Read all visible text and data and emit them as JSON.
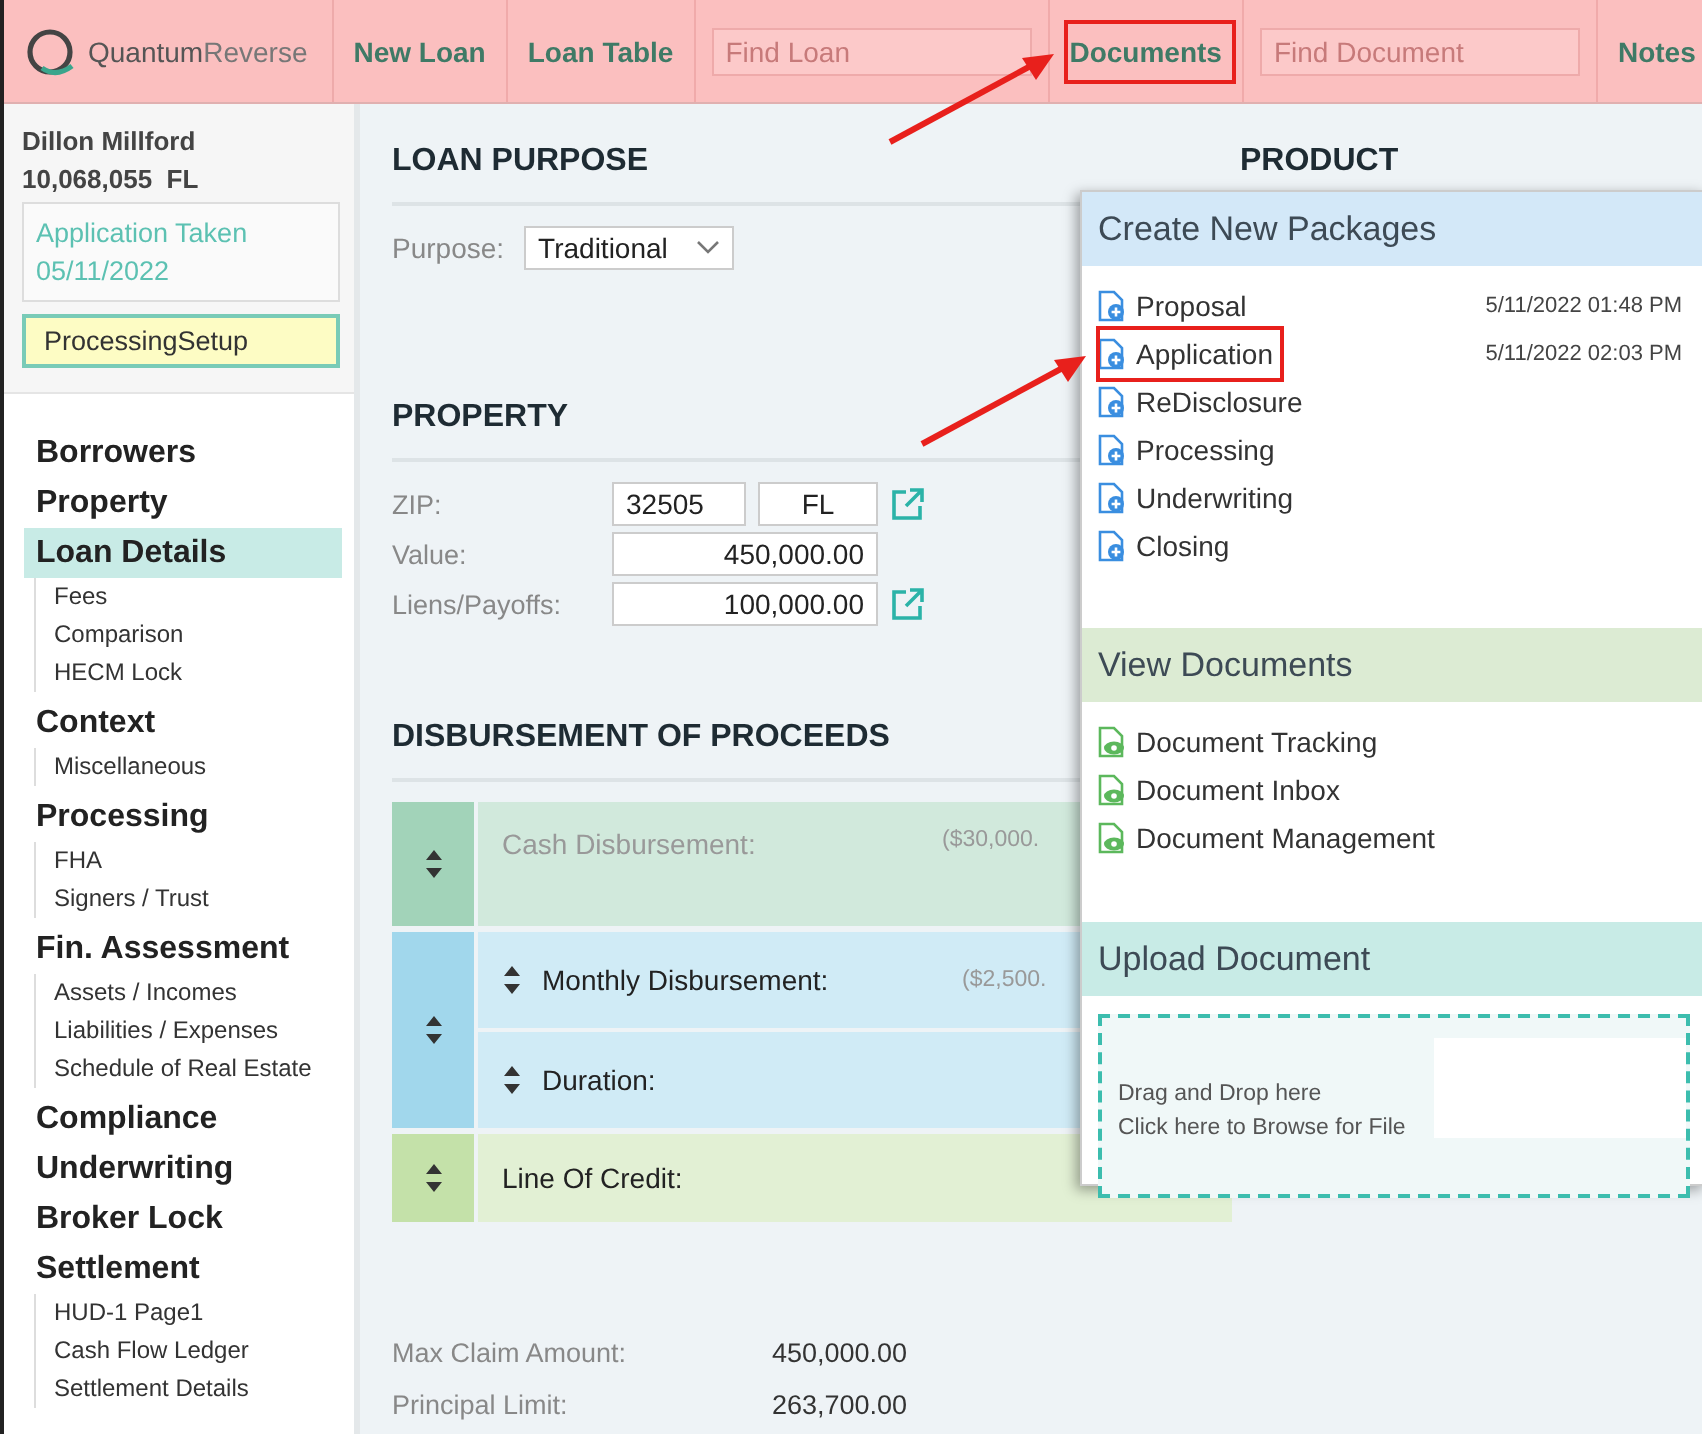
{
  "header": {
    "logo_main": "Quantum",
    "logo_accent": "Reverse",
    "nav": [
      {
        "kind": "link",
        "label": "New Loan",
        "highlighted": false
      },
      {
        "kind": "link",
        "label": "Loan Table",
        "highlighted": false
      },
      {
        "kind": "search",
        "placeholder": "Find Loan",
        "highlighted": false
      },
      {
        "kind": "link",
        "label": "Documents",
        "highlighted": true
      },
      {
        "kind": "search",
        "placeholder": "Find Document",
        "highlighted": false
      },
      {
        "kind": "link",
        "label": "Notes",
        "highlighted": false
      }
    ]
  },
  "borrower": {
    "name": "Dillon Millford",
    "loan_number": "10,068,055",
    "state": "FL",
    "status": "Application Taken",
    "date": "05/11/2022",
    "stage": "ProcessingSetup"
  },
  "sidebar": {
    "groups": [
      {
        "label": "Borrowers",
        "selected": false
      },
      {
        "label": "Property",
        "selected": false
      },
      {
        "label": "Loan Details",
        "selected": true,
        "children": [
          {
            "label": "Fees"
          },
          {
            "label": "Comparison"
          },
          {
            "label": "HECM Lock"
          }
        ]
      },
      {
        "label": "Context",
        "selected": false,
        "children": [
          {
            "label": "Miscellaneous"
          }
        ]
      },
      {
        "label": "Processing",
        "selected": false,
        "children": [
          {
            "label": "FHA"
          },
          {
            "label": "Signers / Trust"
          }
        ]
      },
      {
        "label": "Fin. Assessment",
        "selected": false,
        "children": [
          {
            "label": "Assets / Incomes"
          },
          {
            "label": "Liabilities / Expenses"
          },
          {
            "label": "Schedule of Real Estate"
          }
        ]
      },
      {
        "label": "Compliance",
        "selected": false
      },
      {
        "label": "Underwriting",
        "selected": false
      },
      {
        "label": "Broker Lock",
        "selected": false
      },
      {
        "label": "Settlement",
        "selected": false,
        "children": [
          {
            "label": "HUD-1 Page1"
          },
          {
            "label": "Cash Flow Ledger"
          },
          {
            "label": "Settlement Details"
          }
        ]
      }
    ]
  },
  "loan_purpose": {
    "title": "LOAN PURPOSE",
    "label": "Purpose:",
    "value": "Traditional"
  },
  "property": {
    "title": "PROPERTY",
    "zip_label": "ZIP:",
    "zip": "32505",
    "state": "FL",
    "value_label": "Value:",
    "value": "450,000.00",
    "liens_label": "Liens/Payoffs:",
    "liens": "100,000.00"
  },
  "disbursement": {
    "title": "DISBURSEMENT OF PROCEEDS",
    "rows": [
      {
        "kind": "single",
        "color": "#a2d3b9",
        "disabled": true,
        "label": "Cash Disbursement:",
        "amount": "($30,000."
      },
      {
        "kind": "group",
        "color": "#a1d7ec",
        "items": [
          {
            "label": "Monthly Disbursement:",
            "amount": "($2,500."
          },
          {
            "label": "Duration:"
          }
        ]
      },
      {
        "kind": "single",
        "color": "#c4e1a9",
        "disabled": false,
        "label": "Line Of Credit:"
      }
    ]
  },
  "summary": [
    {
      "label": "Max Claim Amount:",
      "value": "450,000.00"
    },
    {
      "label": "Principal Limit:",
      "value": "263,700.00"
    }
  ],
  "product": {
    "title": "PRODUCT"
  },
  "documents_menu": {
    "sections": [
      {
        "kind": "create",
        "title": "Create New Packages",
        "items": [
          {
            "label": "Proposal",
            "date": "5/11/2022 01:48 PM",
            "highlighted": false
          },
          {
            "label": "Application",
            "date": "5/11/2022 02:03 PM",
            "highlighted": true
          },
          {
            "label": "ReDisclosure",
            "highlighted": false
          },
          {
            "label": "Processing",
            "highlighted": false
          },
          {
            "label": "Underwriting",
            "highlighted": false
          },
          {
            "label": "Closing",
            "highlighted": false
          }
        ]
      },
      {
        "kind": "view",
        "title": "View Documents",
        "items": [
          {
            "label": "Document Tracking",
            "highlighted": false
          },
          {
            "label": "Document Inbox",
            "highlighted": false
          },
          {
            "label": "Document Management",
            "highlighted": false
          }
        ]
      },
      {
        "kind": "upload",
        "title": "Upload Document",
        "lines": [
          "Drag and Drop here",
          "Click here to Browse for File"
        ]
      }
    ]
  }
}
